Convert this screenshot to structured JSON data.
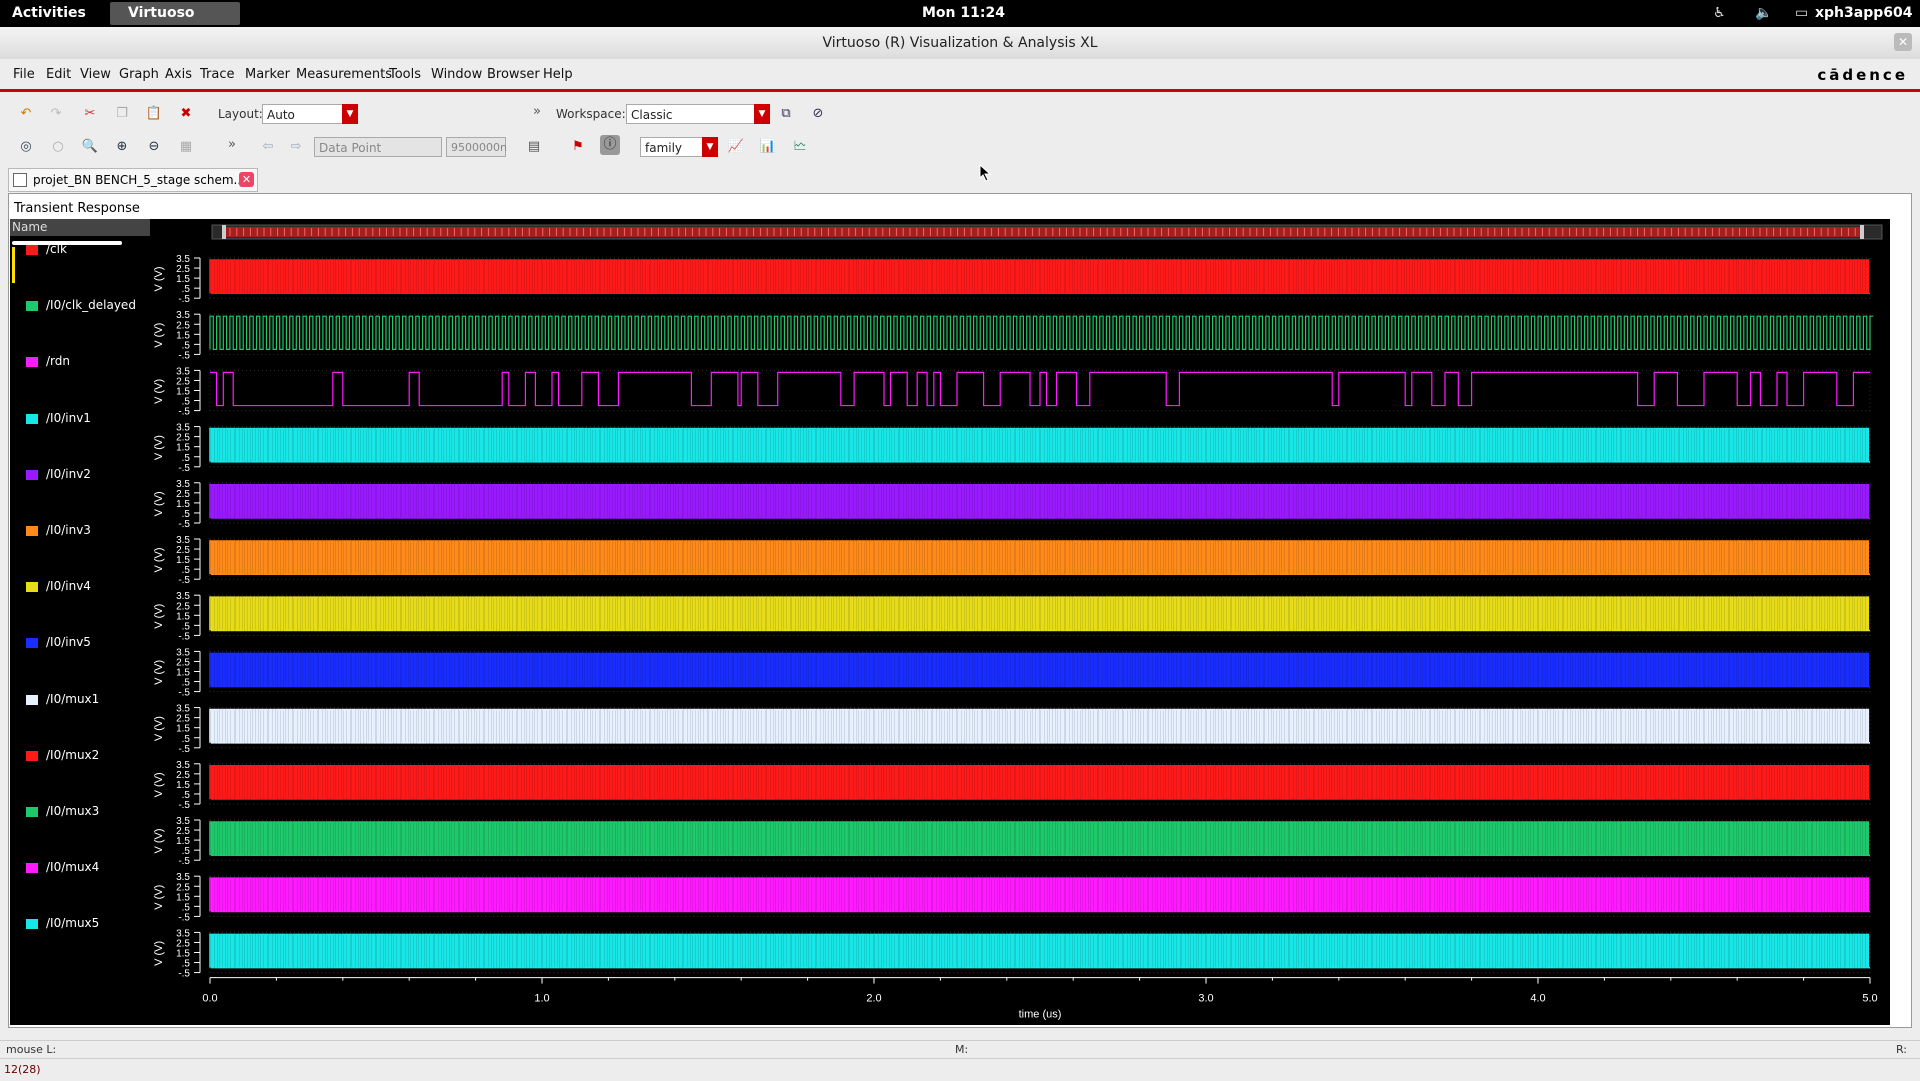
{
  "topbar": {
    "activities": "Activities",
    "app": "Virtuoso",
    "clock": "Mon 11:24",
    "user": "xph3app604"
  },
  "window": {
    "title": "Virtuoso (R) Visualization & Analysis XL",
    "brand": "cādence"
  },
  "menu": [
    "File",
    "Edit",
    "View",
    "Graph",
    "Axis",
    "Trace",
    "Marker",
    "Measurements",
    "Tools",
    "Window",
    "Browser",
    "Help"
  ],
  "toolbar1": {
    "layout_label": "Layout:",
    "layout_value": "Auto",
    "workspace_label": "Workspace:",
    "workspace_value": "Classic"
  },
  "toolbar2": {
    "datapoint": "Data Point",
    "value_field": "9500000n",
    "family": "family"
  },
  "tab": {
    "label": "projet_BN BENCH_5_stage schem..."
  },
  "plot": {
    "title": "Transient Response",
    "legend_header": "Name"
  },
  "colors": {
    "clk": "#ff1a1a",
    "clk_delayed": "#1ec96b",
    "rdn": "#ff1aff",
    "inv1": "#19e6e6",
    "inv2": "#9a1aff",
    "inv3": "#ff8a1a",
    "inv4": "#e6dc19",
    "inv5": "#1a2dff",
    "mux1": "#e6f0ff",
    "mux2": "#ff1a1a",
    "mux3": "#1ec96b",
    "mux4": "#ff1aff",
    "mux5": "#19e6e6"
  },
  "chart_data": {
    "type": "line",
    "xlabel": "time (us)",
    "xlim": [
      0.0,
      5.0
    ],
    "x_ticks": [
      "0.0",
      "1.0",
      "2.0",
      "3.0",
      "4.0",
      "5.0"
    ],
    "ylabel": "V (V)",
    "y_ticks": [
      "3.5",
      "2.5",
      "1.5",
      ".5",
      "-.5"
    ],
    "ylim": [
      -0.5,
      3.5
    ],
    "series": [
      {
        "name": "/clk",
        "color": "#ff1a1a",
        "kind": "square",
        "period_us": 0.01
      },
      {
        "name": "/I0/clk_delayed",
        "color": "#1ec96b",
        "kind": "square",
        "period_us": 0.02
      },
      {
        "name": "/rdn",
        "color": "#ff1aff",
        "kind": "pulse",
        "high": 3.3,
        "low": 0.0
      },
      {
        "name": "/I0/inv1",
        "color": "#19e6e6",
        "kind": "square",
        "period_us": 0.01
      },
      {
        "name": "/I0/inv2",
        "color": "#9a1aff",
        "kind": "square",
        "period_us": 0.01
      },
      {
        "name": "/I0/inv3",
        "color": "#ff8a1a",
        "kind": "square",
        "period_us": 0.01
      },
      {
        "name": "/I0/inv4",
        "color": "#e6dc19",
        "kind": "square",
        "period_us": 0.01
      },
      {
        "name": "/I0/inv5",
        "color": "#1a2dff",
        "kind": "square",
        "period_us": 0.01
      },
      {
        "name": "/I0/mux1",
        "color": "#e6f0ff",
        "kind": "square",
        "period_us": 0.01
      },
      {
        "name": "/I0/mux2",
        "color": "#ff1a1a",
        "kind": "square",
        "period_us": 0.01
      },
      {
        "name": "/I0/mux3",
        "color": "#1ec96b",
        "kind": "square",
        "period_us": 0.01
      },
      {
        "name": "/I0/mux4",
        "color": "#ff1aff",
        "kind": "square",
        "period_us": 0.01
      },
      {
        "name": "/I0/mux5",
        "color": "#19e6e6",
        "kind": "square",
        "period_us": 0.01
      }
    ],
    "grid": false,
    "legend": "left"
  },
  "status": {
    "left": "mouse L:",
    "mid": "M:",
    "right": "R:",
    "page": "12(28)"
  }
}
